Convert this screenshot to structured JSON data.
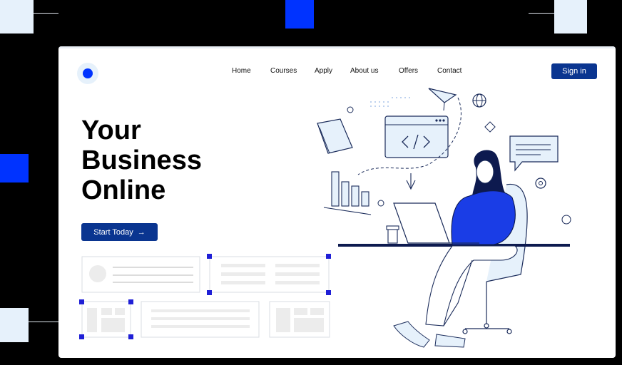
{
  "nav": {
    "links": [
      "Home",
      "Courses",
      "Apply",
      "About us",
      "Offers",
      "Contact"
    ],
    "signin_label": "Sign in"
  },
  "hero": {
    "line1": "Your",
    "line2": "Business",
    "line3": "Online",
    "cta_label": "Start Today",
    "cta_icon": "→"
  },
  "colors": {
    "accent": "#0033ff",
    "button": "#0a3590",
    "light": "#e6f1fb"
  }
}
